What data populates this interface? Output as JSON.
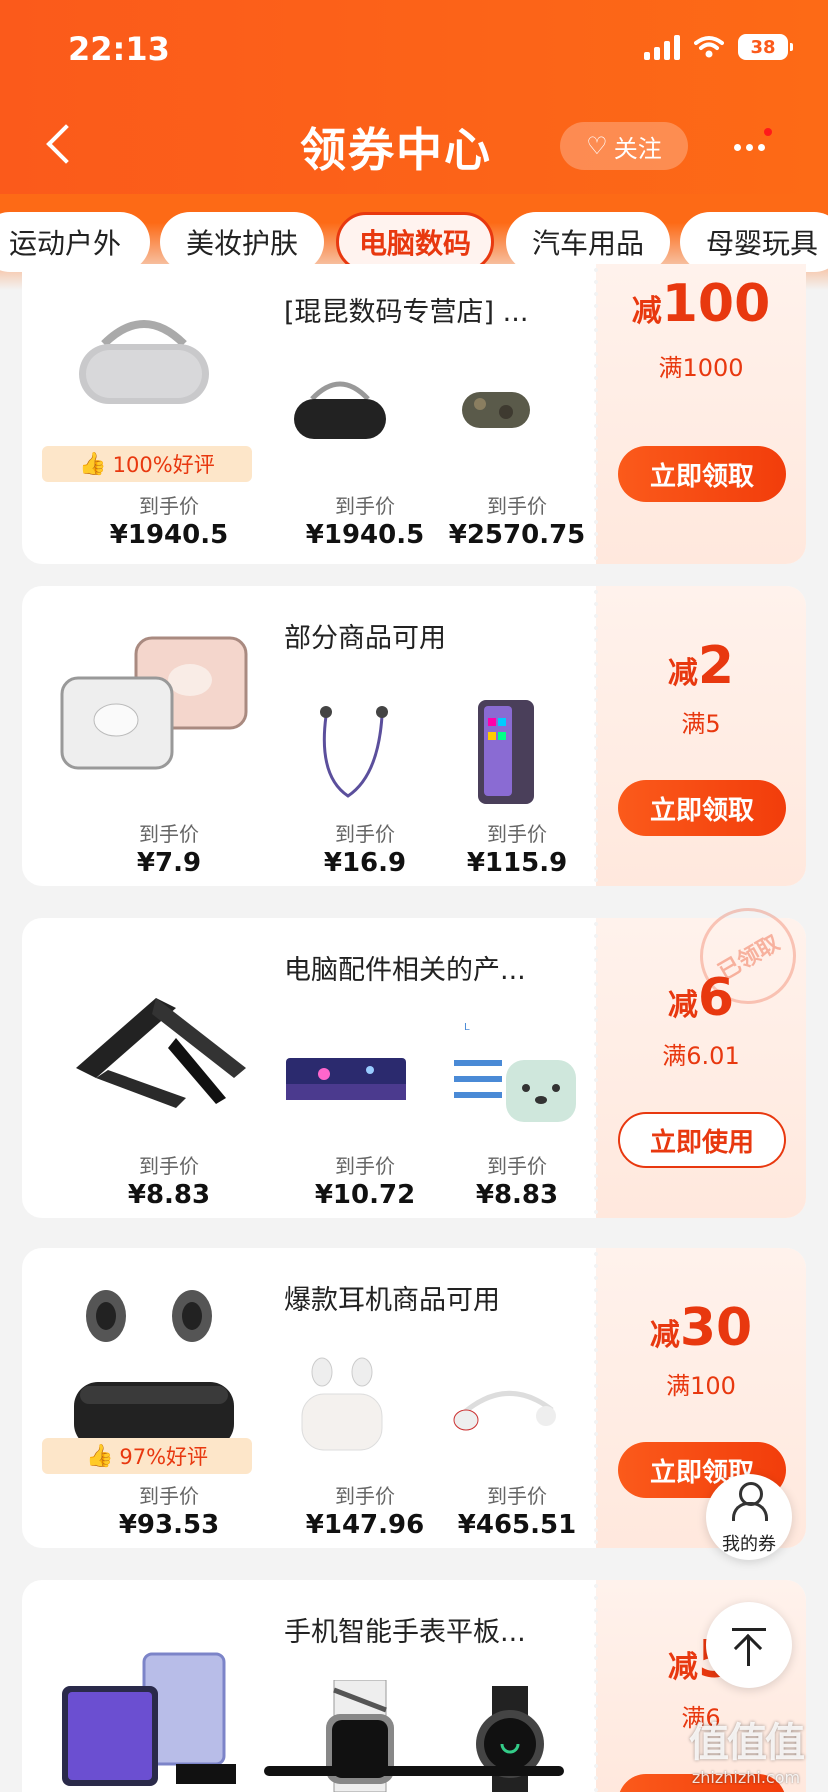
{
  "status": {
    "time": "22:13",
    "battery": "38"
  },
  "header": {
    "title": "领券中心",
    "follow": "关注"
  },
  "tabs": [
    "运动户外",
    "美妆护肤",
    "电脑数码",
    "汽车用品",
    "母婴玩具"
  ],
  "price_label": "到手价",
  "cards": [
    {
      "title": "[琨昆数码专营店] ...",
      "reduce_prefix": "减",
      "reduce_value": "100",
      "threshold": "满1000",
      "button": "立即领取",
      "rating": "100%好评",
      "prices": [
        "¥1940.5",
        "¥1940.5",
        "¥2570.75"
      ]
    },
    {
      "title": "部分商品可用",
      "reduce_prefix": "减",
      "reduce_value": "2",
      "threshold": "满5",
      "button": "立即领取",
      "prices": [
        "¥7.9",
        "¥16.9",
        "¥115.9"
      ]
    },
    {
      "title": "电脑配件相关的产...",
      "reduce_prefix": "减",
      "reduce_value": "6",
      "threshold": "满6.01",
      "button": "立即使用",
      "stamp": "已领取",
      "prices": [
        "¥8.83",
        "¥10.72",
        "¥8.83"
      ]
    },
    {
      "title": "爆款耳机商品可用",
      "reduce_prefix": "减",
      "reduce_value": "30",
      "threshold": "满100",
      "button": "立即领取",
      "rating": "97%好评",
      "prices": [
        "¥93.53",
        "¥147.96",
        "¥465.51"
      ]
    },
    {
      "title": "手机智能手表平板...",
      "reduce_prefix": "减",
      "reduce_value": "5",
      "threshold": "满6"
    }
  ],
  "floating": {
    "my_coupons": "我的券"
  },
  "watermark": {
    "big": "值值值",
    "small": "zhizhizhi.com"
  },
  "colors": {
    "brand": "#fb5a1b",
    "accent_red": "#e8380f"
  }
}
